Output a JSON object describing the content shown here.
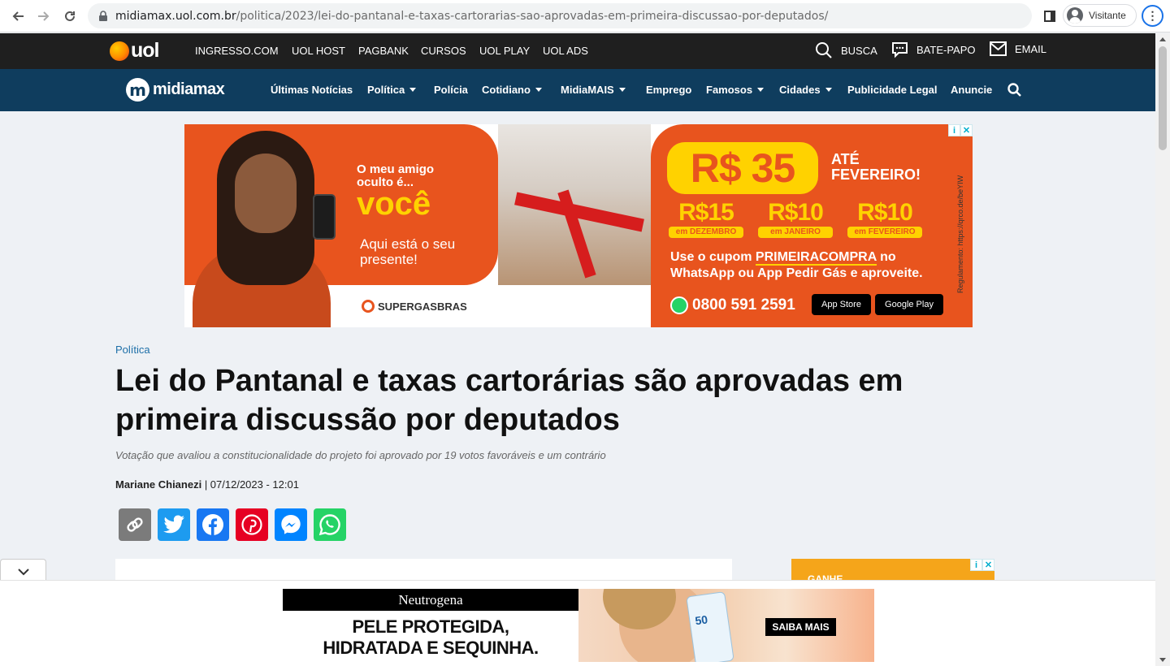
{
  "browser": {
    "url_host": "midiamax.uol.com.br",
    "url_path": "/politica/2023/lei-do-pantanal-e-taxas-cartorarias-sao-aprovadas-em-primeira-discussao-por-deputados/",
    "profile_label": "Visitante"
  },
  "uol_bar": {
    "logo_text": "uol",
    "links": [
      "INGRESSO.COM",
      "UOL HOST",
      "PAGBANK",
      "CURSOS",
      "UOL PLAY",
      "UOL ADS"
    ],
    "search_label": "BUSCA",
    "chat_label": "BATE-PAPO",
    "email_label": "EMAIL"
  },
  "site_nav": {
    "logo_mark": "m",
    "logo_text": "midiamax",
    "items": [
      "Últimas Notícias",
      "Política",
      "Polícia",
      "Cotidiano",
      "MidiaMAIS",
      "Emprego",
      "Famosos",
      "Cidades",
      "Publicidade Legal",
      "Anuncie"
    ]
  },
  "banner_ad": {
    "line1": "O meu amigo oculto é...",
    "highlight": "você",
    "line2": "Aqui está o seu presente!",
    "brand": "SUPERGASBRAS",
    "main_price": "R$ 35",
    "until": "ATÉ FEVEREIRO!",
    "prices": [
      {
        "value": "R$15",
        "month": "em DEZEMBRO"
      },
      {
        "value": "R$10",
        "month": "em JANEIRO"
      },
      {
        "value": "R$10",
        "month": "em FEVEREIRO"
      }
    ],
    "coupon_prefix": "Use o cupom ",
    "coupon_code": "PRIMEIRACOMPRA",
    "coupon_suffix": " no WhatsApp ou App Pedir Gás e aproveite.",
    "phone": "0800 591 2591",
    "app_store": "App Store",
    "google_play": "Google Play",
    "regulation": "Regulamento: https://qrco.de/beYIW"
  },
  "article": {
    "category": "Política",
    "headline": "Lei do Pantanal e taxas cartorárias são aprovadas em primeira discussão por deputados",
    "subhead": "Votação que avaliou a constitucionalidade do projeto foi aprovado por 19 votos favoráveis e um contrário",
    "author": "Mariane Chianezi",
    "date": " | 07/12/2023  - 12:01"
  },
  "share_buttons": [
    {
      "name": "copy-link",
      "color": "#7b7b7b"
    },
    {
      "name": "twitter",
      "color": "#1d9bf0"
    },
    {
      "name": "facebook",
      "color": "#1877f2"
    },
    {
      "name": "pinterest",
      "color": "#e60023"
    },
    {
      "name": "messenger",
      "color": "#0084ff"
    },
    {
      "name": "whatsapp",
      "color": "#25d366"
    }
  ],
  "side_ad": {
    "text": "GANHE"
  },
  "bottom_ad": {
    "brand": "Neutrogena",
    "headline_line1": "PELE PROTEGIDA,",
    "headline_line2": "HIDRATADA E SEQUINHA.",
    "bottle_label": "50",
    "cta": "SAIBA MAIS"
  },
  "colors": {
    "uol_bar": "#1f1f1f",
    "site_nav": "#0f3d5e",
    "ad_orange": "#e8541e",
    "ad_yellow": "#ffd200",
    "category_link": "#1d6fa8"
  }
}
